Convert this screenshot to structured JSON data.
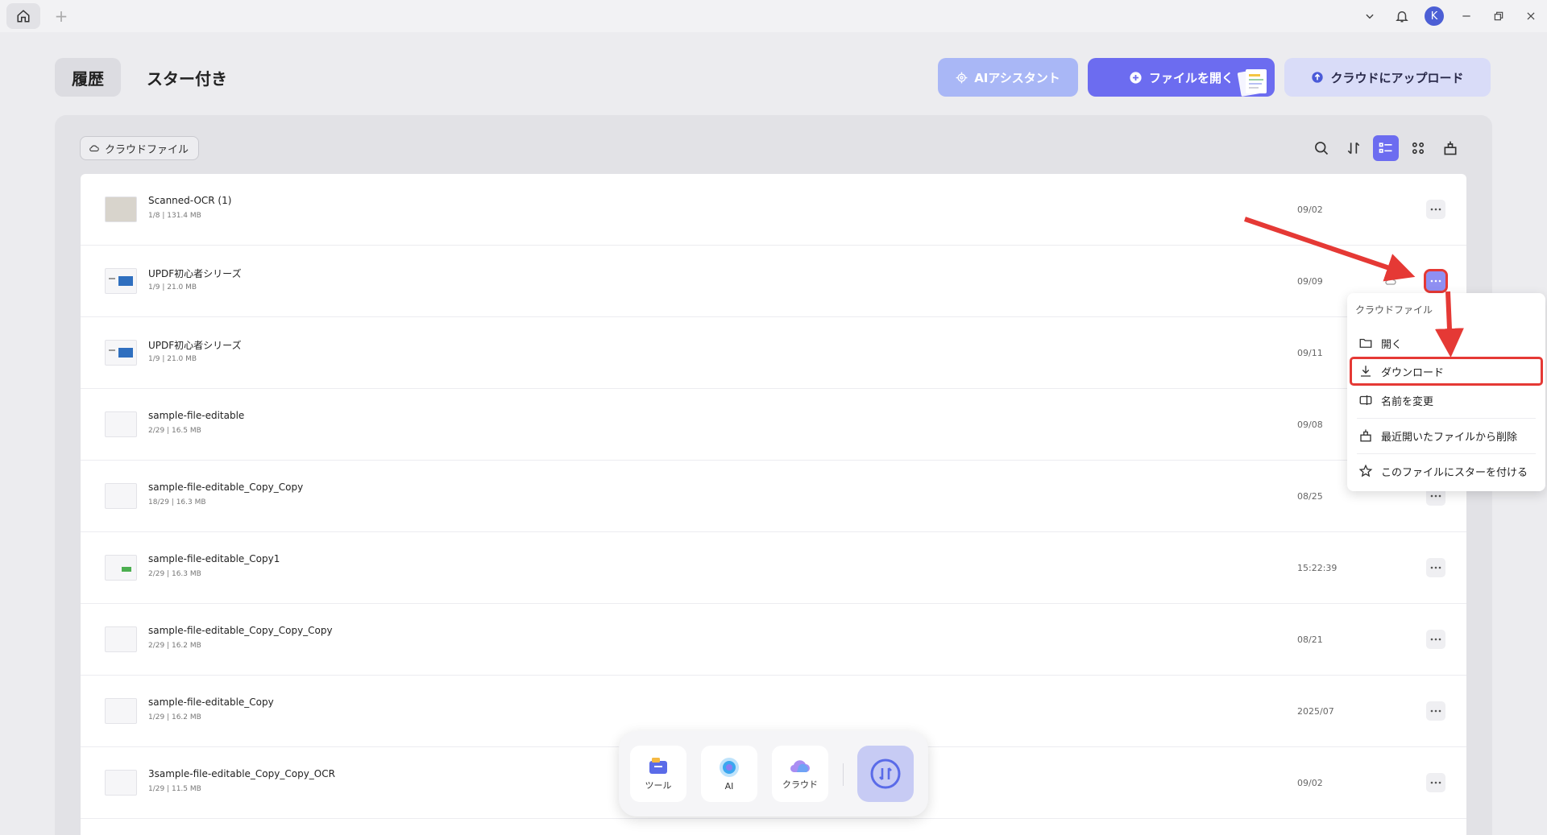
{
  "header": {
    "tab_history": "履歴",
    "tab_starred": "スター付き",
    "btn_ai": "AIアシスタント",
    "btn_open": "ファイルを開く",
    "btn_upload": "クラウドにアップロード"
  },
  "toolbar": {
    "chip": "クラウドファイル"
  },
  "titlebar": {
    "avatar": "K"
  },
  "files": [
    {
      "name": "Scanned-OCR (1)",
      "meta": "1/8 | 131.4 MB",
      "date": "09/02"
    },
    {
      "name": "UPDF初心者シリーズ",
      "meta": "1/9 | 21.0 MB",
      "date": "09/09"
    },
    {
      "name": "UPDF初心者シリーズ",
      "meta": "1/9 | 21.0 MB",
      "date": "09/11"
    },
    {
      "name": "sample-file-editable",
      "meta": "2/29 | 16.5 MB",
      "date": "09/08"
    },
    {
      "name": "sample-file-editable_Copy_Copy",
      "meta": "18/29 | 16.3 MB",
      "date": "08/25"
    },
    {
      "name": "sample-file-editable_Copy1",
      "meta": "2/29 | 16.3 MB",
      "date": "15:22:39"
    },
    {
      "name": "sample-file-editable_Copy_Copy_Copy",
      "meta": "2/29 | 16.2 MB",
      "date": "08/21"
    },
    {
      "name": "sample-file-editable_Copy",
      "meta": "1/29 | 16.2 MB",
      "date": "2025/07"
    },
    {
      "name": "3sample-file-editable_Copy_Copy_OCR",
      "meta": "1/29 | 11.5 MB",
      "date": "09/02"
    }
  ],
  "menu": {
    "title": "クラウドファイル",
    "open": "開く",
    "download": "ダウンロード",
    "rename": "名前を変更",
    "remove": "最近開いたファイルから削除",
    "star": "このファイルにスターを付ける"
  },
  "dock": {
    "tools": "ツール",
    "ai": "AI",
    "cloud": "クラウド"
  },
  "colors": {
    "accent": "#6c6cf0",
    "highlight": "#e53935"
  }
}
